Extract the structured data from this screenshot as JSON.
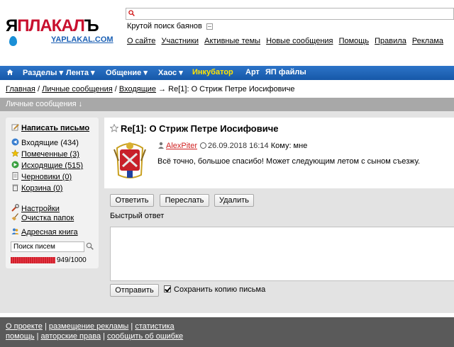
{
  "logo": {
    "main_black": "Я",
    "main_red": "ПЛАКАЛ",
    "main_suffix": "Ъ",
    "sub": "YAPLAKAL.COM"
  },
  "search": {
    "value": "",
    "hint": "Крутой поиск баянов"
  },
  "top_links": [
    "О сайте",
    "Участники",
    "Активные темы",
    "Новые сообщения",
    "Помощь",
    "Правила",
    "Реклама"
  ],
  "nav": {
    "items": [
      "Разделы ▾",
      "Лента ▾",
      "Общение ▾",
      "Хаос ▾",
      "Инкубатор",
      "Арт",
      "ЯП файлы"
    ]
  },
  "breadcrumb": {
    "home": "Главная",
    "pm": "Личные сообщения",
    "inbox": "Входящие",
    "current": "→ Re[1]: О Стриж Петре Иосифовиче",
    "sep": "/"
  },
  "section_title": "Личные сообщения ↓",
  "sidebar": {
    "compose": "Написать письмо",
    "folders": [
      {
        "label": "Входящие (434)",
        "icon": "inbox-icon"
      },
      {
        "label": "Помеченные (3)",
        "icon": "star-icon"
      },
      {
        "label": "Исходящие (515)",
        "icon": "outbox-icon"
      },
      {
        "label": "Черновики (0)",
        "icon": "draft-icon"
      },
      {
        "label": "Корзина (0)",
        "icon": "trash-icon"
      }
    ],
    "settings": "Настройки",
    "clean": "Очистка папок",
    "addressbook": "Адресная книга",
    "search_placeholder": "Поиск писем",
    "quota": "949/1000",
    "quota_fraction": 0.949
  },
  "message": {
    "title": "Re[1]: О Стриж Петре Иосифовиче",
    "author": "AlexPiter",
    "datetime": "26.09.2018 16:14",
    "to": "Кому: мне",
    "body": "Всё точно, большое спасибо! Может следующим летом с сыном съезжу."
  },
  "actions": {
    "reply": "Ответить",
    "forward": "Переслать",
    "delete": "Удалить"
  },
  "quick_reply": {
    "label": "Быстрый ответ",
    "send": "Отправить",
    "save_copy": "Сохранить копию письма"
  },
  "footer": {
    "line1": [
      "О проекте",
      "размещение рекламы",
      "статистика"
    ],
    "line2": [
      "помощь",
      "авторские права",
      "сообщить об ошибке"
    ],
    "sep": "|"
  }
}
